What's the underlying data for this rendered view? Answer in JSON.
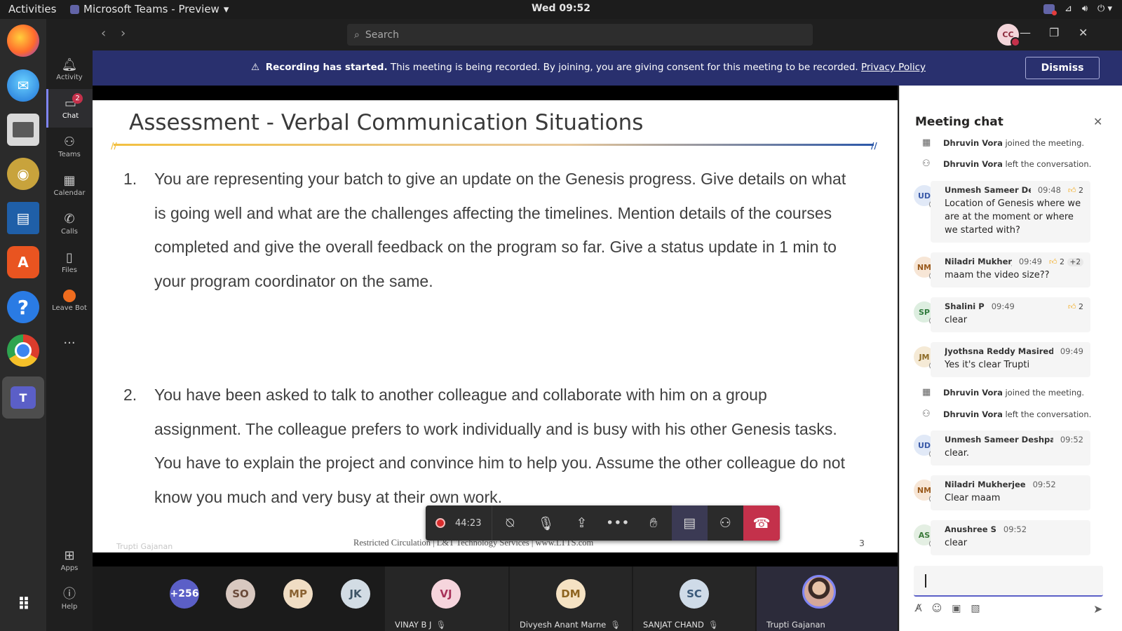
{
  "system_bar": {
    "activities": "Activities",
    "app_title": "Microsoft Teams - Preview",
    "clock": "Wed 09:52"
  },
  "dock": {
    "items": [
      "firefox-icon",
      "thunderbird-icon",
      "files-icon",
      "rhythmbox-icon",
      "writer-icon",
      "software-icon",
      "help-icon",
      "chrome-icon",
      "teams-icon",
      "show-apps-icon"
    ],
    "teams_label": "T"
  },
  "rail": {
    "activity": "Activity",
    "chat": "Chat",
    "chat_badge": "2",
    "teams": "Teams",
    "calendar": "Calendar",
    "calls": "Calls",
    "files": "Files",
    "leave_bot": "Leave Bot",
    "more": "...",
    "apps": "Apps",
    "help": "Help"
  },
  "titlebar": {
    "search_placeholder": "Search",
    "avatar": "CC"
  },
  "banner": {
    "bold": "Recording has started.",
    "message": " This meeting is being recorded. By joining, you are giving consent for this meeting to be recorded. ",
    "link": "Privacy Policy",
    "dismiss": "Dismiss",
    "color": "#29306e"
  },
  "slide": {
    "title": "Assessment - Verbal Communication Situations",
    "q1_num": "1.",
    "q1_text": "You are representing your batch to give an update on the Genesis progress. Give details on what is going well and what are the challenges affecting the timelines. Mention details of the courses completed and give the overall feedback on the program so far. Give a status update in 1 min to your program coordinator on the same.",
    "q2_num": "2.",
    "q2_text": "You have been asked to talk to another colleague and collaborate with him on a group assignment. The colleague prefers to work individually and is busy with his other Genesis tasks. You have to explain the project and convince him to help you. Assume the other colleague do not know you much and very busy at their own work.",
    "footer": "Restricted Circulation | L&T Technology Services | www.LTTS.com",
    "page": "3",
    "presenter_watermark": "Trupti Gajanan"
  },
  "controls": {
    "timer": "44:23",
    "hangup_color": "#c4314b"
  },
  "participants": {
    "overflow": "+256",
    "avatars": [
      "SO",
      "MP",
      "JK"
    ],
    "tiles": [
      {
        "initials": "VJ",
        "name": "VINAY B J"
      },
      {
        "initials": "DM",
        "name": "Divyesh Anant Marne"
      },
      {
        "initials": "SC",
        "name": "SANJAT CHAND"
      },
      {
        "initials": "",
        "name": "Trupti Gajanan"
      }
    ]
  },
  "chat": {
    "title": "Meeting chat",
    "sys1": {
      "name": "Dhruvin Vora",
      "text": "joined the meeting."
    },
    "sys2": {
      "name": "Dhruvin Vora",
      "text": "left the conversation."
    },
    "m1": {
      "initials": "UD",
      "name": "Unmesh Sameer Des...",
      "time": "09:48",
      "reactions": "2",
      "body": "Location of Genesis where we are at the moment or where we started with?"
    },
    "m2": {
      "initials": "NM",
      "name": "Niladri Mukherje...",
      "time": "09:49",
      "reactions": "2",
      "more": "+2",
      "body": "maam the video size??"
    },
    "m3": {
      "initials": "SP",
      "name": "Shalini P",
      "time": "09:49",
      "reactions": "2",
      "body": "clear"
    },
    "m4": {
      "initials": "JM",
      "name": "Jyothsna Reddy Masireddy",
      "time": "09:49",
      "body": "Yes it's clear Trupti"
    },
    "sys3": {
      "name": "Dhruvin Vora",
      "text": "joined the meeting."
    },
    "sys4": {
      "name": "Dhruvin Vora",
      "text": "left the conversation."
    },
    "m5": {
      "initials": "UD",
      "name": "Unmesh Sameer Deshpande",
      "time": "09:52",
      "body": "clear."
    },
    "m6": {
      "initials": "NM",
      "name": "Niladri Mukherjee",
      "time": "09:52",
      "body": "Clear maam"
    },
    "m7": {
      "initials": "AS",
      "name": "Anushree S",
      "time": "09:52",
      "body": "clear"
    }
  }
}
